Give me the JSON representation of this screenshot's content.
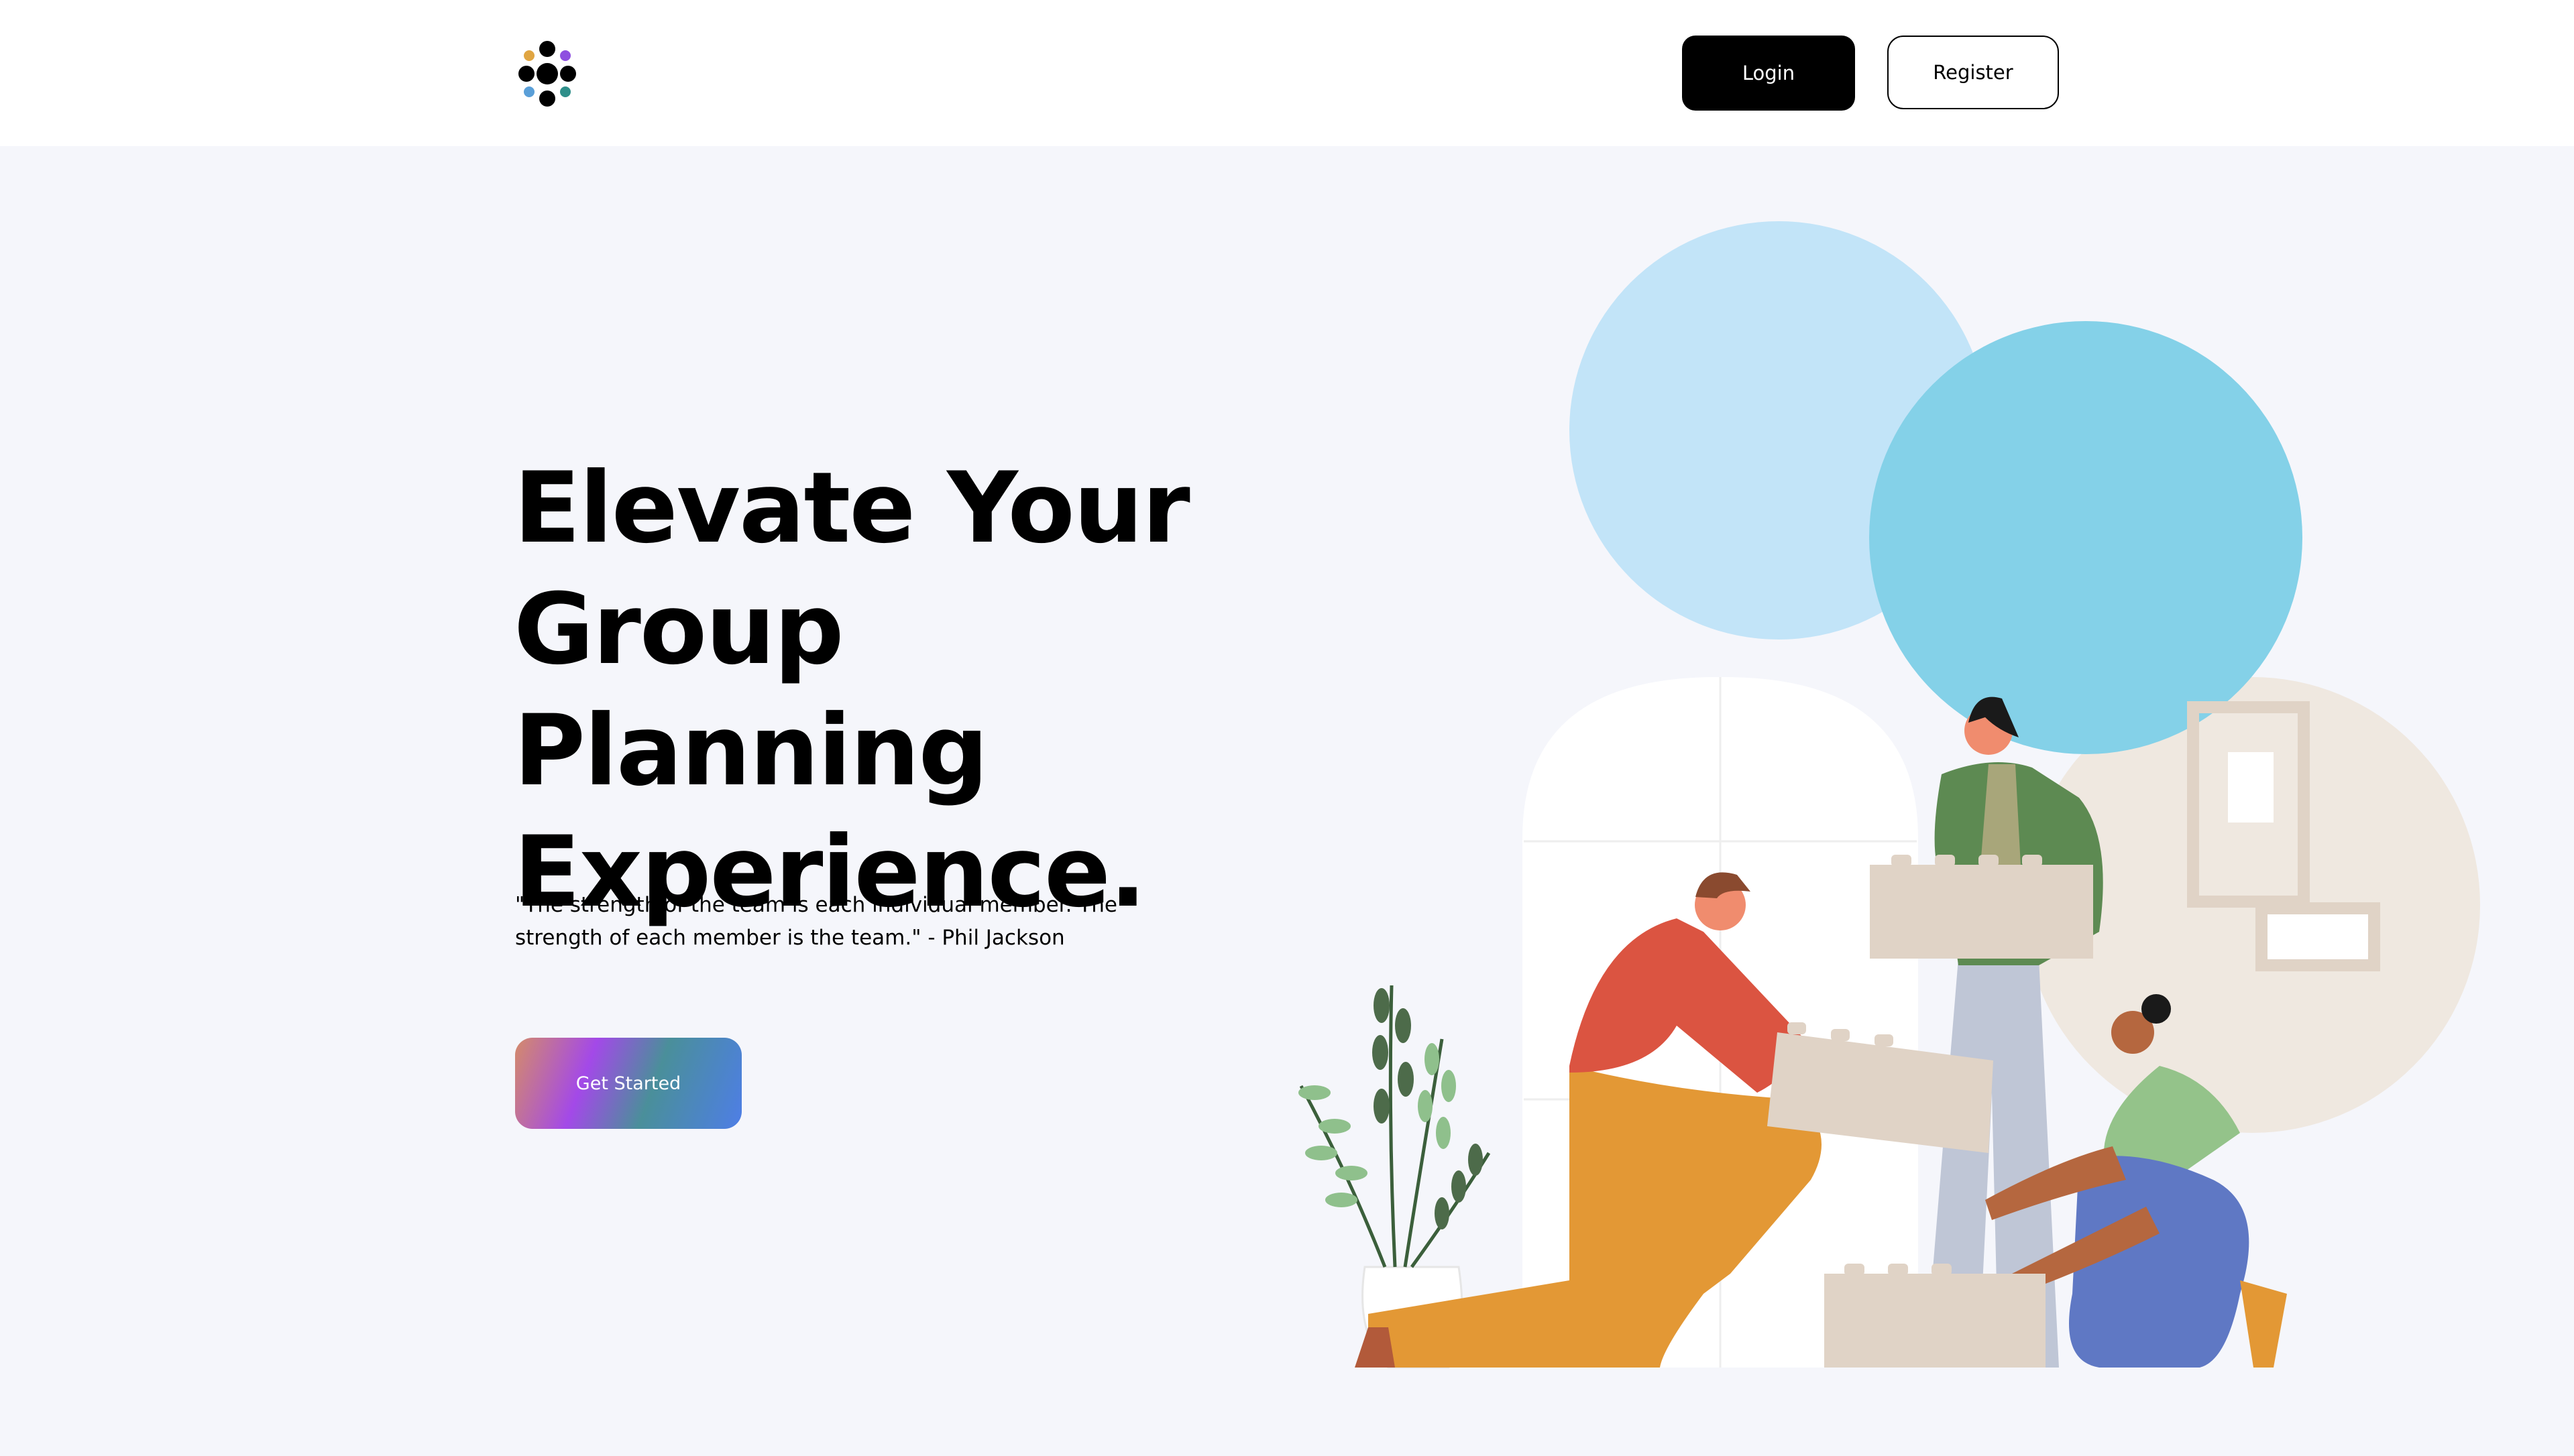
{
  "header": {
    "login_label": "Login",
    "register_label": "Register"
  },
  "hero": {
    "title_line1": "Elevate Your",
    "title_line2": "Group Planning",
    "title_line3": "Experience.",
    "quote": "\"The strength of the team is each individual member. The strength of each member is the team.\" - Phil Jackson",
    "cta_label": "Get Started"
  },
  "colors": {
    "page_bg": "#f5f6fb",
    "header_bg": "#ffffff",
    "login_bg": "#000000",
    "circle_light_blue": "#c2e4f8",
    "circle_blue": "#84d1e8",
    "circle_beige": "#efe8e0"
  },
  "icons": {
    "logo": "dots-flower-logo"
  }
}
